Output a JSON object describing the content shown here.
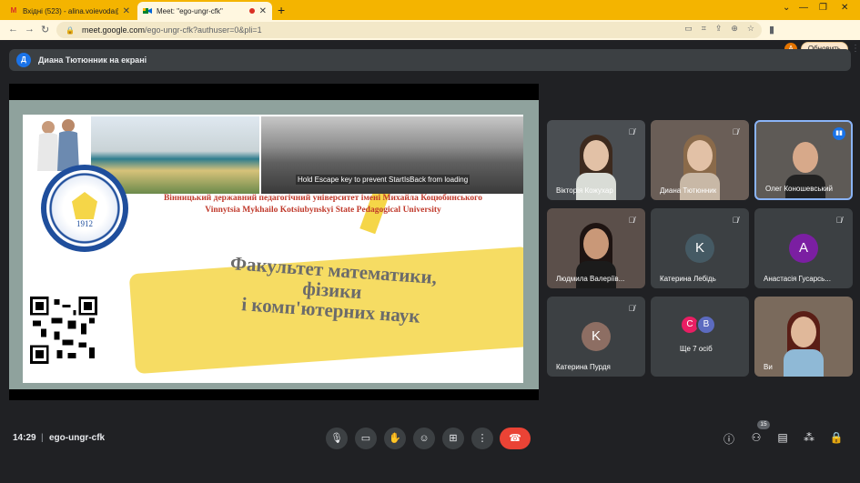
{
  "browser": {
    "tabs": [
      {
        "label": "Вхідні (523) - alina.voievoda@vs",
        "favicon": "M"
      },
      {
        "label": "Meet: \"ego-ungr-cfk\"",
        "favicon": "meet"
      }
    ],
    "new_tab": "+",
    "url_host": "meet.google.com",
    "url_path": "/ego-ungr-cfk?authuser=0&pli=1",
    "profile_initial": "A",
    "update_label": "Обновить"
  },
  "presenter": {
    "initial": "Д",
    "label": "Диана Тютюнник на екрані"
  },
  "slide": {
    "overlay_text": "Hold Escape key to prevent StartIsBack from loading",
    "seal_year": "1912",
    "university_ua": "Вінницький державний педагогічний університет імені Михайла Коцюбинського",
    "university_en": "Vinnytsia Mykhailo Kotsiubynskyi State Pedagogical University",
    "faculty_line1": "Факультет математики,",
    "faculty_line2": "фізики",
    "faculty_line3": "і комп'ютерних наук"
  },
  "participants": [
    {
      "name": "Вікторія Кожухар",
      "type": "video",
      "muted": true
    },
    {
      "name": "Диана Тютюнник",
      "type": "video",
      "muted": true
    },
    {
      "name": "Олег Коношевський",
      "type": "video",
      "muted": false,
      "speaking": true
    },
    {
      "name": "Людмила Валеріїв...",
      "type": "video",
      "muted": true
    },
    {
      "name": "Катерина Лебідь",
      "type": "avatar",
      "initial": "K",
      "color": "#455a64",
      "muted": true
    },
    {
      "name": "Анастасія Гусарсь...",
      "type": "avatar",
      "initial": "A",
      "color": "#7b1fa2",
      "muted": true
    },
    {
      "name": "Катерина Пурдя",
      "type": "avatar",
      "initial": "K",
      "color": "#8d6e63",
      "muted": true
    },
    {
      "name": "Ще 7 осіб",
      "type": "more",
      "initials": [
        "C",
        "B"
      ],
      "colors": [
        "#e91e63",
        "#5c6bc0"
      ]
    },
    {
      "name": "Ви",
      "type": "video",
      "muted": false
    }
  ],
  "bottom_bar": {
    "time": "14:29",
    "separator": "|",
    "meeting_code": "ego-ungr-cfk",
    "participant_count": "15"
  },
  "colors": {
    "chrome_accent": "#f4b400",
    "end_call": "#ea4335",
    "meet_bg": "#202124",
    "tile_bg": "#3c4043"
  }
}
